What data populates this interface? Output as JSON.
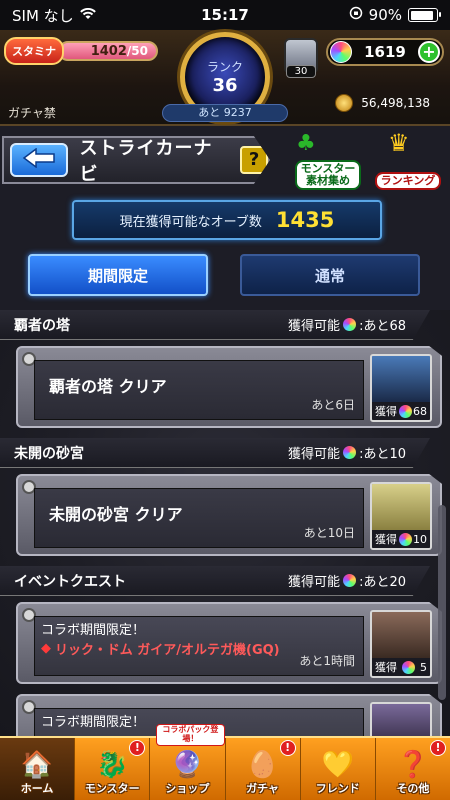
{
  "status_bar": {
    "carrier": "SIM なし",
    "time": "15:17",
    "battery": "90%",
    "battery_level": 0.9
  },
  "header": {
    "stamina_label": "スタミナ",
    "stamina_current": "1402",
    "stamina_max": "/50",
    "rank_label": "ランク",
    "rank_value": "36",
    "rank_remaining": "あと 9237",
    "gacha_ban": "ガチャ禁",
    "box_count": "30",
    "orbs": "1619",
    "coins": "56,498,138"
  },
  "title_bar": {
    "title": "ストライカーナビ",
    "help": "?",
    "monster_material_line1": "モンスター",
    "monster_material_line2": "素材集め",
    "ranking": "ランキング"
  },
  "orb_info": {
    "label": "現在獲得可能なオーブ数",
    "value": "1435"
  },
  "tabs": [
    {
      "label": "期間限定",
      "active": true
    },
    {
      "label": "通常",
      "active": false
    }
  ],
  "sections": [
    {
      "name": "覇者の塔",
      "available": "獲得可能",
      "remaining": ":あと68",
      "card": {
        "name": "覇者の塔 クリア",
        "time_left": "あと6日",
        "reward_label": "獲得",
        "reward_value": "68"
      }
    },
    {
      "name": "未開の砂宮",
      "available": "獲得可能",
      "remaining": ":あと10",
      "card": {
        "name": "未開の砂宮 クリア",
        "time_left": "あと10日",
        "reward_label": "獲得",
        "reward_value": "10"
      }
    },
    {
      "name": "イベントクエスト",
      "available": "獲得可能",
      "remaining": ":あと20",
      "card": {
        "tag": "コラボ期間限定！",
        "name": "リック・ドム ガイア/オルテガ機(GQ)",
        "time_left": "あと1時間",
        "reward_label": "獲得",
        "reward_value": "5"
      },
      "card2": {
        "tag": "コラボ期間限定！"
      }
    }
  ],
  "bottom_nav": [
    {
      "label": "ホーム",
      "icon": "home-icon"
    },
    {
      "label": "モンスター",
      "icon": "monster-icon",
      "badge": "!"
    },
    {
      "label": "ショップ",
      "icon": "shop-icon",
      "popup": "コラボパック登場！"
    },
    {
      "label": "ガチャ",
      "icon": "gacha-icon",
      "badge": "!"
    },
    {
      "label": "フレンド",
      "icon": "friend-icon"
    },
    {
      "label": "その他",
      "icon": "other-icon",
      "badge": "!"
    }
  ]
}
